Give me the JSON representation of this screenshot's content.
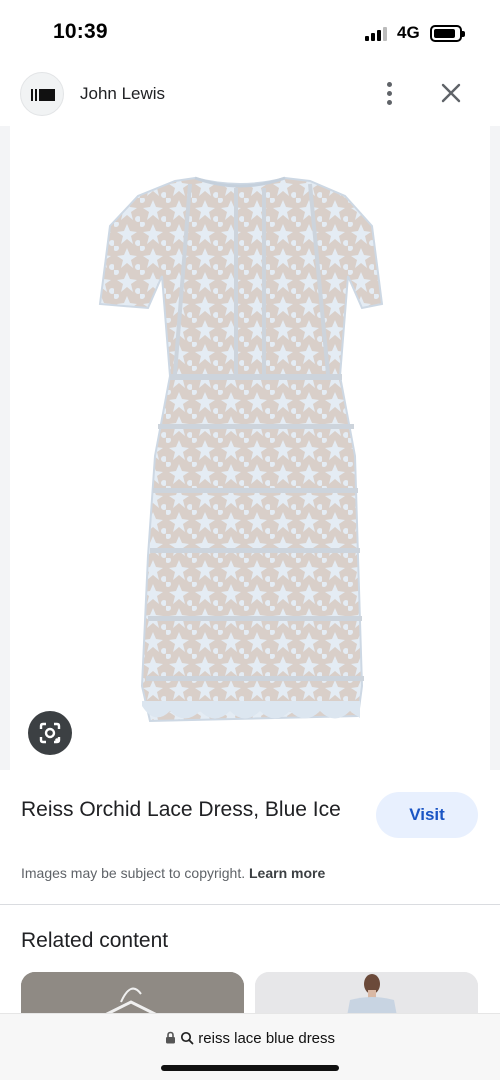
{
  "status_bar": {
    "time": "10:39",
    "network": "4G"
  },
  "header": {
    "site_name": "John Lewis",
    "logo_icon": "john-lewis-logo",
    "menu_icon": "more-vert-icon",
    "close_icon": "close-icon"
  },
  "image": {
    "lens_icon": "google-lens-icon",
    "dress_color": "#dce6f0"
  },
  "product": {
    "title": "Reiss Orchid Lace Dress, Blue Ice",
    "visit_label": "Visit",
    "copyright_text": "Images may be subject to copyright.",
    "learn_more_label": "Learn more"
  },
  "related": {
    "title": "Related content"
  },
  "url_bar": {
    "url": "reiss lace blue dress",
    "lock_icon": "lock-icon",
    "search_icon": "search-icon"
  },
  "colors": {
    "accent": "#1a55c4",
    "visit_bg": "#e8f0fe"
  }
}
